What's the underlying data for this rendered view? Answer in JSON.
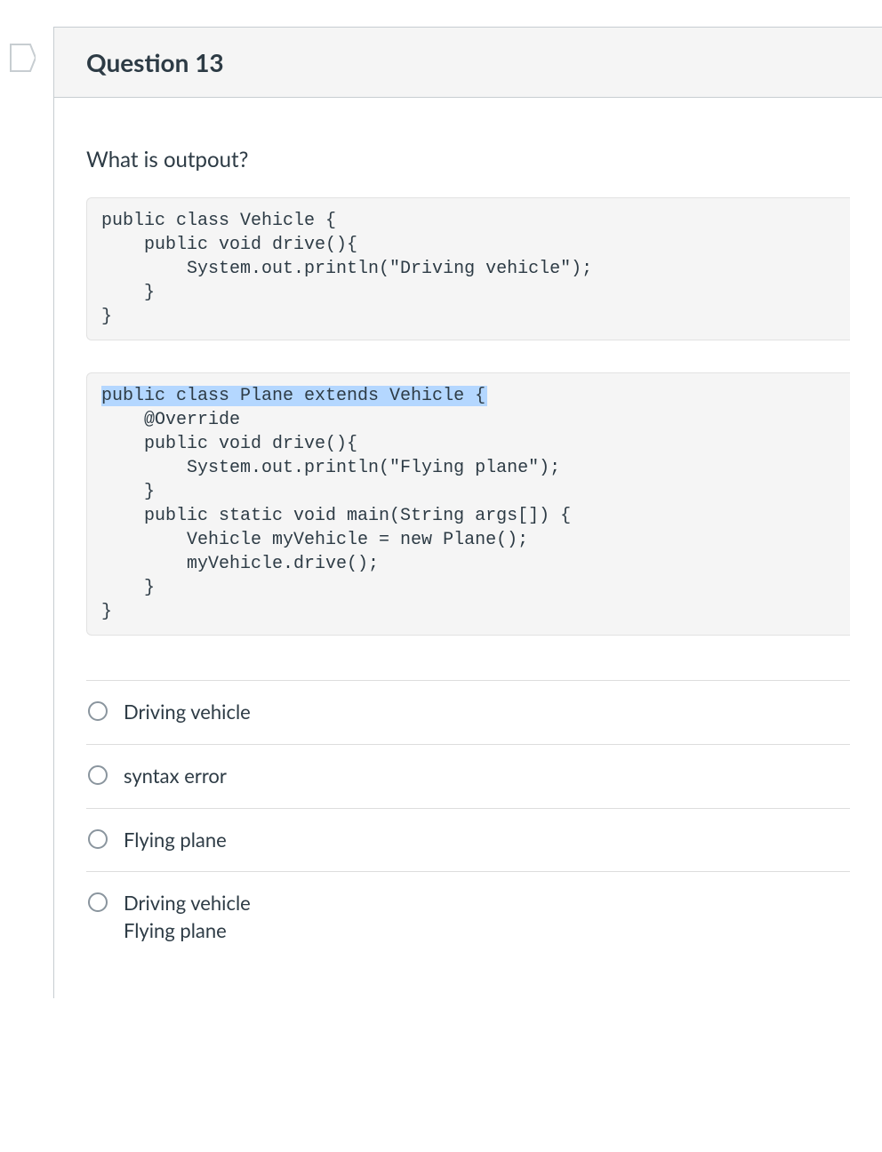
{
  "question": {
    "title": "Question 13",
    "prompt": "What is outpout?",
    "code_block_1": "public class Vehicle {\n    public void drive(){\n        System.out.println(\"Driving vehicle\");\n    }\n}",
    "code_block_2_highlight": "public class Plane extends Vehicle {",
    "code_block_2_rest": "\n    @Override\n    public void drive(){\n        System.out.println(\"Flying plane\");\n    }\n    public static void main(String args[]) {\n        Vehicle myVehicle = new Plane();\n        myVehicle.drive();\n    }\n}",
    "answers": [
      "Driving vehicle",
      "syntax error",
      "Flying plane",
      "Driving vehicle\nFlying plane"
    ]
  }
}
